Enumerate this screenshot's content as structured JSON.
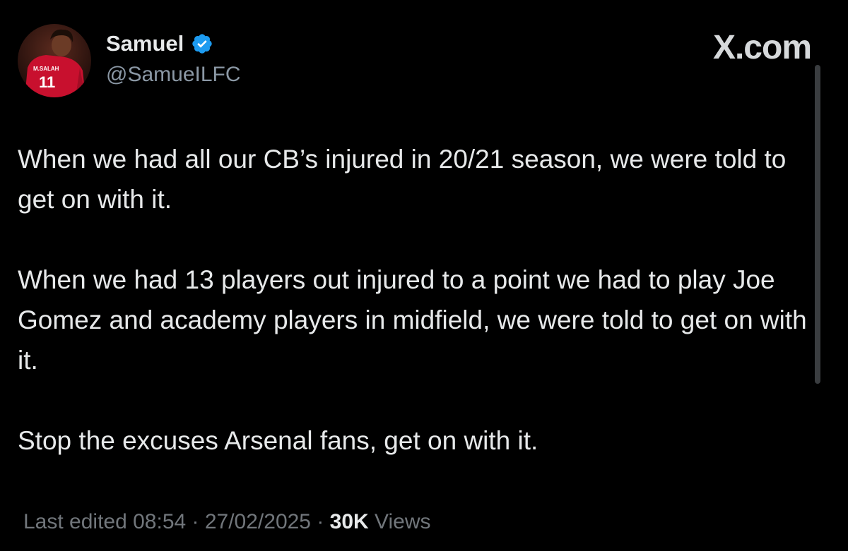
{
  "author": {
    "display_name": "Samuel",
    "handle": "@SamueILFC",
    "verified": true,
    "avatar_jersey_name": "M.SALAH",
    "avatar_jersey_number": "11"
  },
  "watermark": "X.com",
  "tweet": {
    "paragraphs": [
      "When we had all our CB’s injured in 20/21 season, we were told to get on with it.",
      "When we had 13 players out injured to a point we had to play Joe Gomez and academy players in midfield, we were told to get on with it.",
      "Stop the excuses Arsenal fans, get on with it."
    ]
  },
  "meta": {
    "edited_label": "Last edited 08:54 · 27/02/2025",
    "separator": " · ",
    "views_count": "30K",
    "views_label": " Views"
  },
  "colors": {
    "background": "#000000",
    "text": "#e7e9ea",
    "muted": "#71767b",
    "verified": "#1d9bf0"
  }
}
